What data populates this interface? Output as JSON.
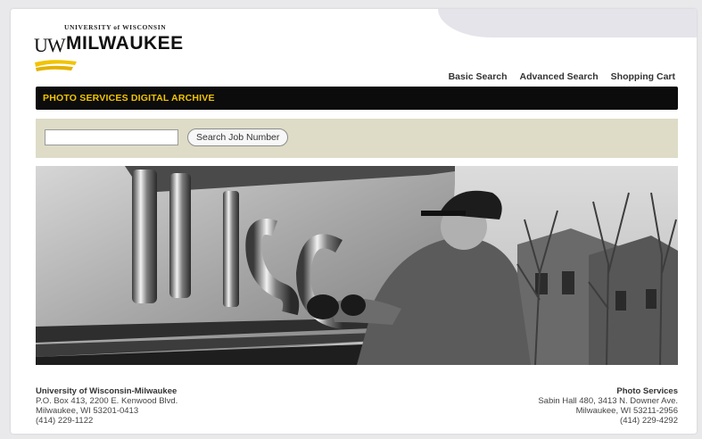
{
  "logo": {
    "small_text": "UNIVERSITY of WISCONSIN",
    "uw": "UW",
    "name": "MILWAUKEE",
    "accent_color": "#f1c400"
  },
  "nav": {
    "items": [
      "Basic Search",
      "Advanced Search",
      "Shopping Cart"
    ]
  },
  "titlebar": {
    "text": "PHOTO SERVICES DIGITAL ARCHIVE",
    "bg": "#0c0c0c",
    "fg": "#f1c400"
  },
  "search": {
    "value": "",
    "placeholder": "",
    "button_label": "Search Job Number"
  },
  "hero": {
    "description_icon": "photo-icon"
  },
  "footer": {
    "left": {
      "name": "University of Wisconsin-Milwaukee",
      "line1": "P.O. Box 413, 2200 E. Kenwood Blvd.",
      "line2": "Milwaukee, WI 53201-0413",
      "phone": "(414) 229-1122"
    },
    "right": {
      "name": "Photo Services",
      "line1": "Sabin Hall 480, 3413 N. Downer Ave.",
      "line2": "Milwaukee, WI 53211-2956",
      "phone": "(414) 229-4292"
    }
  }
}
